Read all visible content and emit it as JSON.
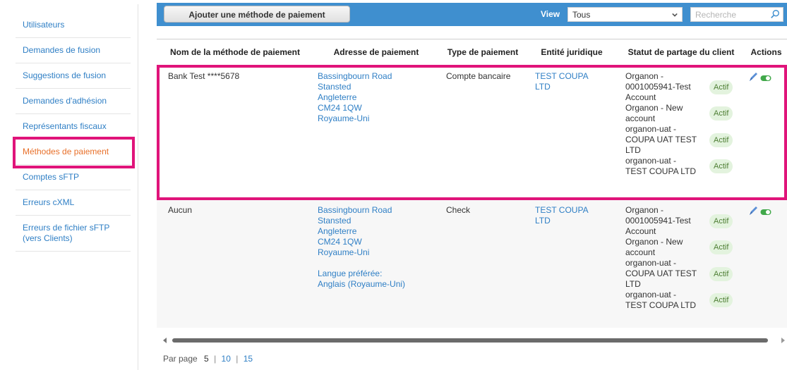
{
  "sidebar": {
    "items": [
      {
        "label": "Utilisateurs"
      },
      {
        "label": "Demandes de fusion"
      },
      {
        "label": "Suggestions de fusion"
      },
      {
        "label": "Demandes d'adhésion"
      },
      {
        "label": "Représentants fiscaux"
      },
      {
        "label": "Méthodes de paiement"
      },
      {
        "label": "Comptes sFTP"
      },
      {
        "label": "Erreurs cXML"
      },
      {
        "label": "Erreurs de fichier sFTP (vers Clients)"
      }
    ],
    "active_label": "Méthodes de paiement"
  },
  "toolbar": {
    "add_button_label": "Ajouter une méthode de paiement",
    "view_label": "View",
    "view_selected": "Tous",
    "search_placeholder": "Recherche"
  },
  "table": {
    "headers": [
      "Nom de la méthode de paiement",
      "Adresse de paiement",
      "Type de paiement",
      "Entité juridique",
      "Statut de partage du client",
      "Actions"
    ],
    "rows": [
      {
        "name": "Bank Test ****5678",
        "address": [
          "Bassingbourn Road",
          "Stansted",
          "Angleterre",
          "CM24 1QW",
          "Royaume-Uni"
        ],
        "address_extra": "",
        "type": "Compte bancaire",
        "entity": "TEST COUPA LTD",
        "statuses": [
          {
            "text": "Organon - 0001005941-Test Account",
            "badge": "Actif"
          },
          {
            "text": "Organon - New account",
            "badge": "Actif"
          },
          {
            "text": "organon-uat - COUPA UAT TEST LTD",
            "badge": "Actif"
          },
          {
            "text": "organon-uat - TEST COUPA LTD",
            "badge": "Actif"
          }
        ]
      },
      {
        "name": "Aucun",
        "address": [
          "Bassingbourn Road",
          "Stansted",
          "Angleterre",
          "CM24 1QW",
          "Royaume-Uni"
        ],
        "address_extra": "Langue préférée: Anglais (Royaume-Uni)",
        "type": "Check",
        "entity": "TEST COUPA LTD",
        "statuses": [
          {
            "text": "Organon - 0001005941-Test Account",
            "badge": "Actif"
          },
          {
            "text": "Organon - New account",
            "badge": "Actif"
          },
          {
            "text": "organon-uat - COUPA UAT TEST LTD",
            "badge": "Actif"
          },
          {
            "text": "organon-uat - TEST COUPA LTD",
            "badge": "Actif"
          }
        ]
      }
    ]
  },
  "pagination": {
    "label": "Par page",
    "current": "5",
    "options": [
      "10",
      "15"
    ]
  },
  "colors": {
    "toolbar_bg": "#3f8fcf",
    "link": "#2f7fc5",
    "active_nav": "#e8702a",
    "highlight": "#e0147a",
    "badge_bg": "#e3f3de"
  },
  "icons": {
    "edit": "pencil-icon",
    "toggle": "toggle-on-icon",
    "search": "search-icon",
    "dropdown": "chevron-down-icon"
  }
}
